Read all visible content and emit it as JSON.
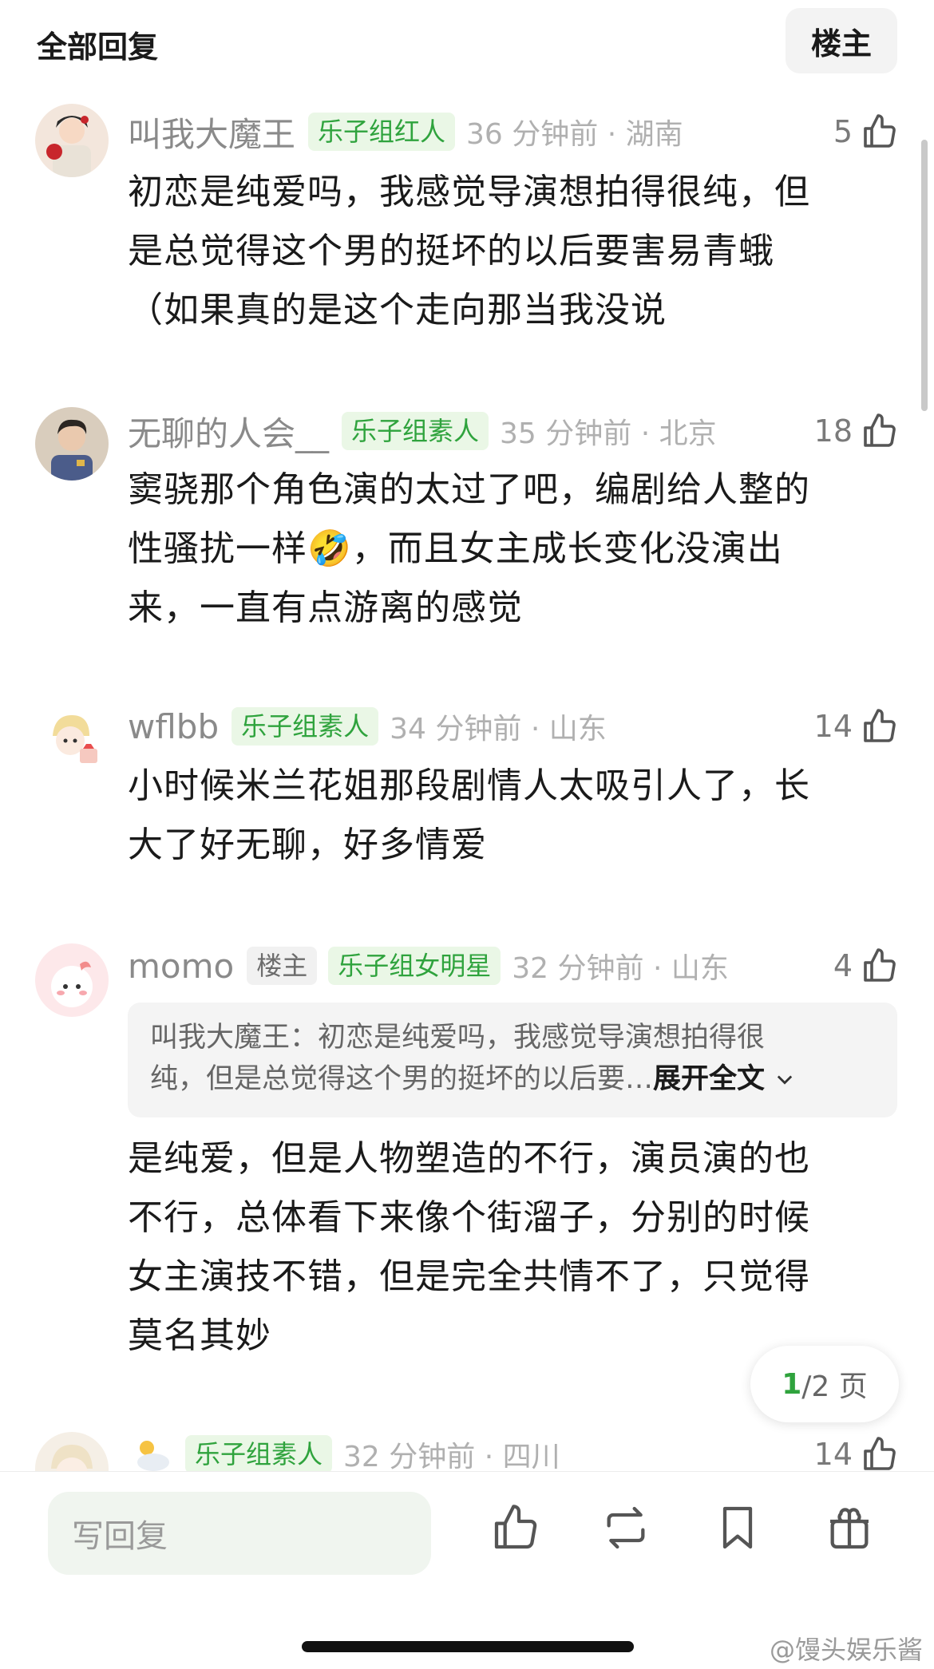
{
  "header": {
    "title": "全部回复",
    "filter_button": "楼主"
  },
  "comments": [
    {
      "username": "叫我大魔王",
      "badge": "乐子组红人",
      "time": "36 分钟前 · 湖南",
      "likes": "5",
      "text": [
        "初恋是纯爱吗，我感觉导演想拍得很纯，但",
        "是总觉得这个男的挺坏的以后要害易青蛾",
        "（如果真的是这个走向那当我没说"
      ]
    },
    {
      "username": "无聊的人会__",
      "badge": "乐子组素人",
      "time": "35 分钟前 · 北京",
      "likes": "18",
      "text": [
        "窦骁那个角色演的太过了吧，编剧给人整的",
        "性骚扰一样🤣，而且女主成长变化没演出",
        "来，一直有点游离的感觉"
      ]
    },
    {
      "username": "wflbb",
      "badge": "乐子组素人",
      "time": "34 分钟前 · 山东",
      "likes": "14",
      "text": [
        "小时候米兰花姐那段剧情人太吸引人了，长",
        "大了好无聊，好多情爱"
      ]
    },
    {
      "username": "momo",
      "op_badge": "楼主",
      "badge": "乐子组女明星",
      "time": "32 分钟前 · 山东",
      "likes": "4",
      "quote": {
        "line1": "叫我大魔王：初恋是纯爱吗，我感觉导演想拍得很",
        "line2": "纯，但是总觉得这个男的挺坏的以后要…",
        "expand": "展开全文"
      },
      "text": [
        "是纯爱，但是人物塑造的不行，演员演的也",
        "不行，总体看下来像个街溜子，分别的时候",
        "女主演技不错，但是完全共情不了，只觉得",
        "莫名其妙"
      ]
    },
    {
      "badge": "乐子组素人",
      "time": "32 分钟前 · 四川",
      "likes": "14"
    }
  ],
  "pager": {
    "current": "1",
    "total": "/2 页"
  },
  "bottom_bar": {
    "reply_placeholder": "写回复",
    "icons": [
      "thumbs-up-icon",
      "repost-icon",
      "bookmark-icon",
      "gift-icon"
    ]
  },
  "watermark": "@馒头娱乐酱",
  "colors": {
    "accent_green": "#2fa33d",
    "badge_bg": "#eaf7e6",
    "meta_grey": "#8a8a8a"
  }
}
